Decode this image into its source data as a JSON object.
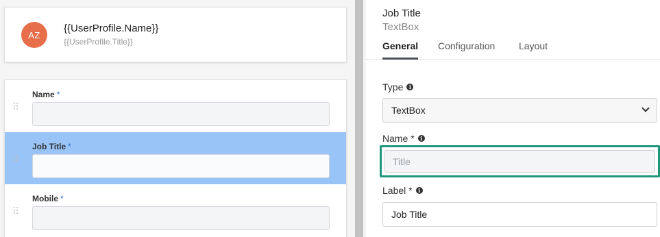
{
  "profile": {
    "initials": "AZ",
    "name": "{{UserProfile.Name}}",
    "title": "{{UserProfile.Title}}"
  },
  "form": {
    "fields": [
      {
        "label": "Name",
        "required": "*"
      },
      {
        "label": "Job Title",
        "required": "*"
      },
      {
        "label": "Mobile",
        "required": "*"
      }
    ]
  },
  "properties": {
    "title": "Job Title",
    "subtitle": "TextBox",
    "tabs": [
      "General",
      "Configuration",
      "Layout"
    ],
    "type_label": "Type",
    "type_value": "TextBox",
    "name_label": "Name *",
    "name_placeholder": "Title",
    "label_label": "Label *",
    "label_value": "Job Title"
  },
  "colors": {
    "avatar": "#e66e4a",
    "selected_row": "#99c4f8",
    "focus_outline": "#1f9679",
    "required_star": "#2a6fd6"
  }
}
